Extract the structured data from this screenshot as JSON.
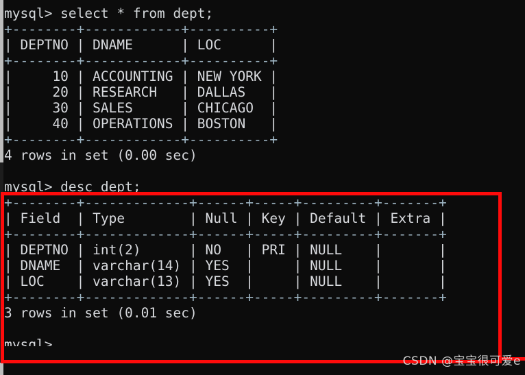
{
  "terminal": {
    "background": "#0c0c0c",
    "foreground": "#d8dade",
    "border_color": "#fe0b0b",
    "scrollbar_color": "#bdbdbd"
  },
  "session": {
    "block1": {
      "prompt": "mysql> select * from dept;",
      "table": {
        "rule_top": "+--------+------------+----------+",
        "header": "| DEPTNO | DNAME      | LOC      |",
        "rule_mid": "+--------+------------+----------+",
        "rows": [
          "|     10 | ACCOUNTING | NEW YORK |",
          "|     20 | RESEARCH   | DALLAS   |",
          "|     30 | SALES      | CHICAGO  |",
          "|     40 | OPERATIONS | BOSTON   |"
        ],
        "rule_bottom": "+--------+------------+----------+",
        "columns": [
          "DEPTNO",
          "DNAME",
          "LOC"
        ],
        "data": [
          [
            "10",
            "ACCOUNTING",
            "NEW YORK"
          ],
          [
            "20",
            "RESEARCH",
            "DALLAS"
          ],
          [
            "30",
            "SALES",
            "CHICAGO"
          ],
          [
            "40",
            "OPERATIONS",
            "BOSTON"
          ]
        ]
      },
      "status": "4 rows in set (0.00 sec)"
    },
    "block2": {
      "prompt": "mysql> desc dept;",
      "table": {
        "rule_top": "+--------+-------------+------+-----+---------+-------+",
        "header": "| Field  | Type        | Null | Key | Default | Extra |",
        "rule_mid": "+--------+-------------+------+-----+---------+-------+",
        "rows": [
          "| DEPTNO | int(2)      | NO   | PRI | NULL    |       |",
          "| DNAME  | varchar(14) | YES  |     | NULL    |       |",
          "| LOC    | varchar(13) | YES  |     | NULL    |       |"
        ],
        "rule_bottom": "+--------+-------------+------+-----+---------+-------+",
        "columns": [
          "Field",
          "Type",
          "Null",
          "Key",
          "Default",
          "Extra"
        ],
        "data": [
          [
            "DEPTNO",
            "int(2)",
            "NO",
            "PRI",
            "NULL",
            ""
          ],
          [
            "DNAME",
            "varchar(14)",
            "YES",
            "",
            "NULL",
            ""
          ],
          [
            "LOC",
            "varchar(13)",
            "YES",
            "",
            "NULL",
            ""
          ]
        ]
      },
      "status": "3 rows in set (0.01 sec)"
    },
    "block3": {
      "prompt_partial": "mysql>"
    }
  },
  "watermark": {
    "text": "CSDN @宝宝很可爱e"
  }
}
